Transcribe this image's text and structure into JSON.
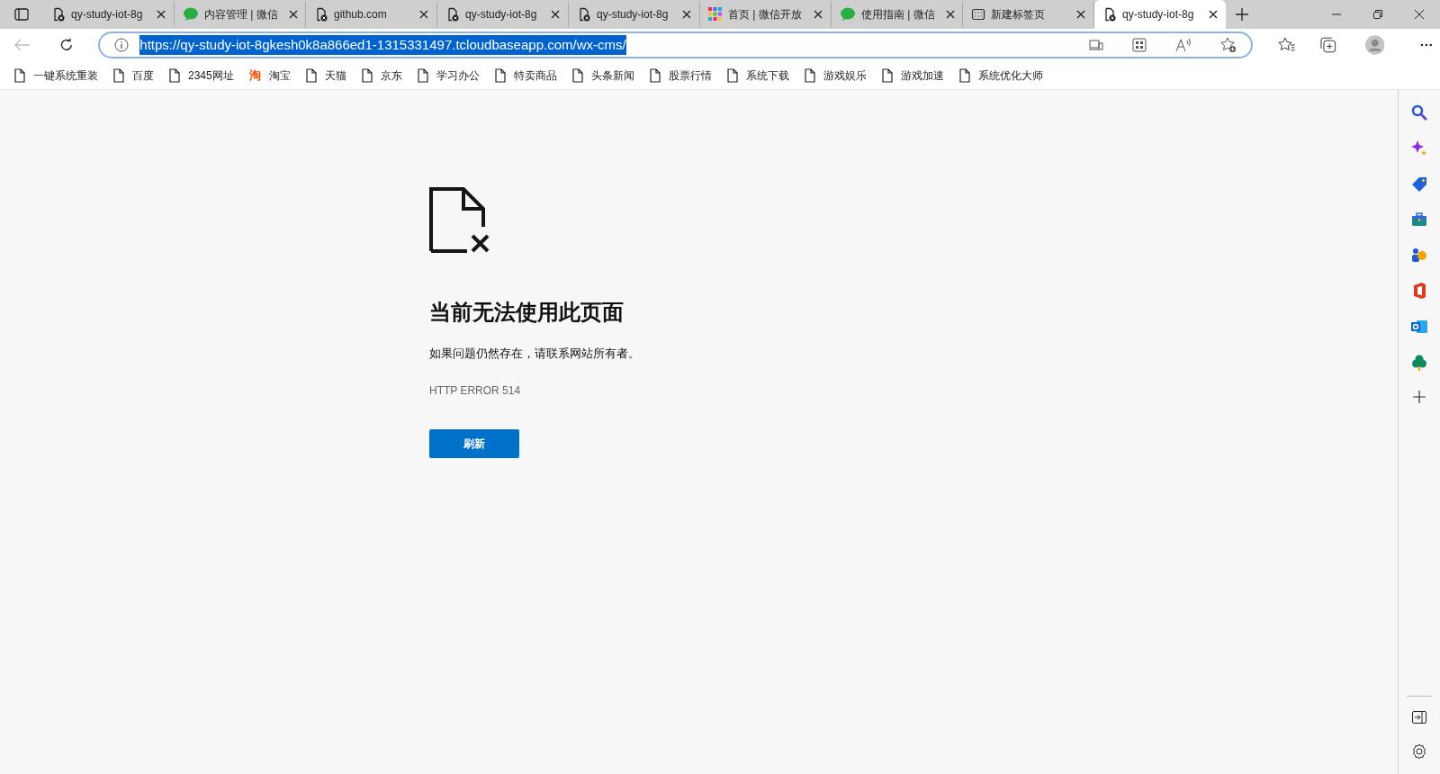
{
  "tabs": [
    {
      "title": "qy-study-iot-8g",
      "kind": "doc-error",
      "selected": false
    },
    {
      "title": "内容管理 | 微信",
      "kind": "chat",
      "selected": false
    },
    {
      "title": "github.com",
      "kind": "doc-error",
      "selected": false
    },
    {
      "title": "qy-study-iot-8g",
      "kind": "doc-error",
      "selected": false
    },
    {
      "title": "qy-study-iot-8g",
      "kind": "doc-error",
      "selected": false
    },
    {
      "title": "首页 | 微信开放",
      "kind": "grid",
      "selected": false
    },
    {
      "title": "使用指南 | 微信",
      "kind": "chat",
      "selected": false
    },
    {
      "title": "新建标签页",
      "kind": "newtab",
      "selected": false
    },
    {
      "title": "qy-study-iot-8g",
      "kind": "doc-error",
      "selected": true
    }
  ],
  "address_bar": {
    "url": "https://qy-study-iot-8gkesh0k8a866ed1-1315331497.tcloudbaseapp.com/wx-cms/",
    "selected": true
  },
  "bookmarks": [
    {
      "label": "一键系统重装",
      "kind": "page"
    },
    {
      "label": "百度",
      "kind": "page"
    },
    {
      "label": "2345网址",
      "kind": "page"
    },
    {
      "label": "淘宝",
      "kind": "logo",
      "logo": "淘"
    },
    {
      "label": "天猫",
      "kind": "page"
    },
    {
      "label": "京东",
      "kind": "page"
    },
    {
      "label": "学习办公",
      "kind": "page"
    },
    {
      "label": "特卖商品",
      "kind": "page"
    },
    {
      "label": "头条新闻",
      "kind": "page"
    },
    {
      "label": "股票行情",
      "kind": "page"
    },
    {
      "label": "系统下载",
      "kind": "page"
    },
    {
      "label": "游戏娱乐",
      "kind": "page"
    },
    {
      "label": "游戏加速",
      "kind": "page"
    },
    {
      "label": "系统优化大师",
      "kind": "page"
    }
  ],
  "error_page": {
    "title": "当前无法使用此页面",
    "message": "如果问题仍然存在，请联系网站所有者。",
    "code": "HTTP ERROR 514",
    "button": "刷新"
  }
}
